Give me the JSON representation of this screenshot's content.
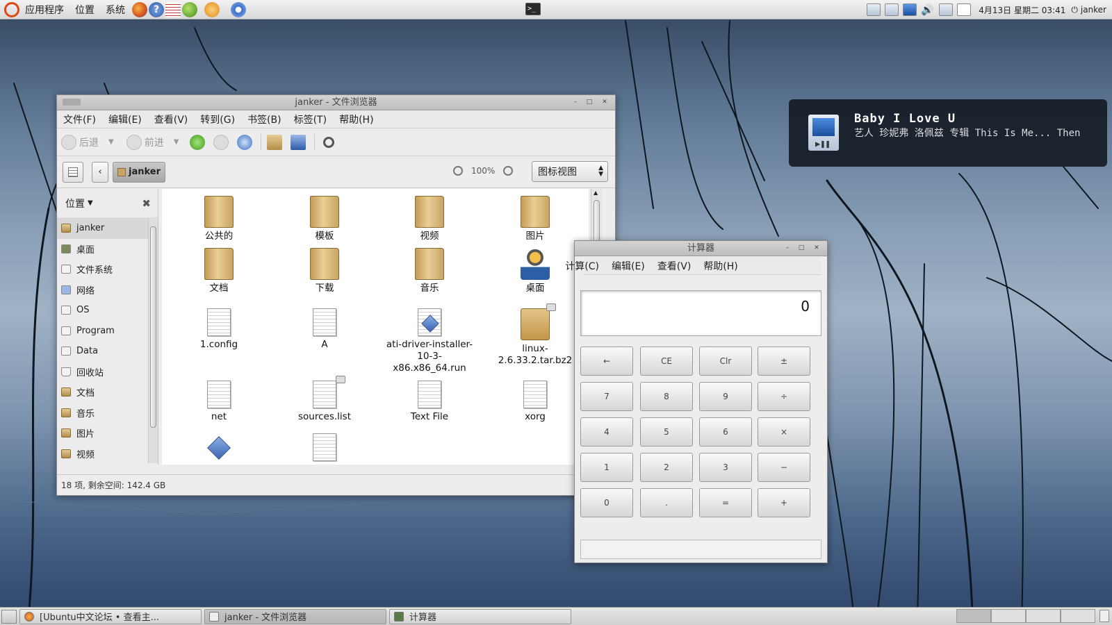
{
  "top_panel": {
    "menus": [
      "应用程序",
      "位置",
      "系统"
    ],
    "launchers": [
      "firefox-icon",
      "help-icon",
      "text-editor-icon",
      "green-apple-icon",
      "music-player-icon",
      "chromium-icon"
    ],
    "clock": "4月13日 星期二 03:41",
    "user": "janker"
  },
  "notification": {
    "title": "Baby I Love U",
    "body": "艺人 珍妮弗 洛佩兹 专辑 This Is Me... Then"
  },
  "file_manager": {
    "title": "janker - 文件浏览器",
    "menu": [
      "文件(F)",
      "编辑(E)",
      "查看(V)",
      "转到(G)",
      "书签(B)",
      "标签(T)",
      "帮助(H)"
    ],
    "toolbar": {
      "back": "后退",
      "forward": "前进"
    },
    "location": {
      "crumb": "janker",
      "zoom": "100%",
      "view": "图标视图"
    },
    "sidebar": {
      "header": "位置",
      "items": [
        "janker",
        "桌面",
        "文件系统",
        "网络",
        "OS",
        "Program",
        "Data",
        "回收站",
        "文档",
        "音乐",
        "图片",
        "视频"
      ]
    },
    "files": [
      {
        "name": "公共的",
        "type": "folder"
      },
      {
        "name": "模板",
        "type": "folder"
      },
      {
        "name": "视频",
        "type": "folder"
      },
      {
        "name": "图片",
        "type": "folder"
      },
      {
        "name": "文档",
        "type": "folder"
      },
      {
        "name": "下载",
        "type": "folder"
      },
      {
        "name": "音乐",
        "type": "folder"
      },
      {
        "name": "桌面",
        "type": "desktop"
      },
      {
        "name": "1.config",
        "type": "doc"
      },
      {
        "name": "A",
        "type": "doc"
      },
      {
        "name": "ati-driver-installer-10-3-x86.x86_64.run",
        "type": "script"
      },
      {
        "name": "linux-2.6.33.2.tar.bz2",
        "type": "archive"
      },
      {
        "name": "net",
        "type": "doc"
      },
      {
        "name": "sources.list",
        "type": "doc-locked"
      },
      {
        "name": "Text File",
        "type": "doc"
      },
      {
        "name": "xorg",
        "type": "doc"
      },
      {
        "name": "",
        "type": "script"
      },
      {
        "name": "",
        "type": "doc"
      }
    ],
    "status": "18 项, 剩余空间: 142.4 GB"
  },
  "calculator": {
    "title": "计算器",
    "menu": [
      "计算(C)",
      "编辑(E)",
      "查看(V)",
      "帮助(H)"
    ],
    "display": "0",
    "keys": [
      [
        "←",
        "CE",
        "Clr",
        "±"
      ],
      [
        "7",
        "8",
        "9",
        "÷"
      ],
      [
        "4",
        "5",
        "6",
        "×"
      ],
      [
        "1",
        "2",
        "3",
        "−"
      ],
      [
        "0",
        ".",
        "=",
        "+"
      ]
    ]
  },
  "taskbar": {
    "tasks": [
      "[Ubuntu中文论坛 • 查看主...",
      "janker - 文件浏览器",
      "计算器"
    ]
  }
}
